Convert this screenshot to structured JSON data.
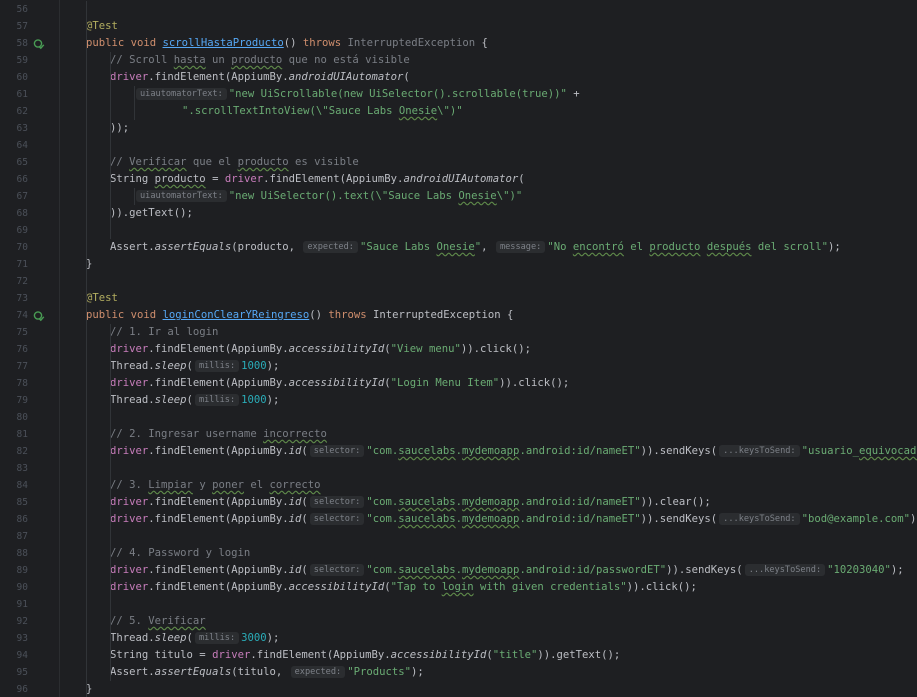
{
  "editor": {
    "language": "java",
    "colors": {
      "background": "#1e1f22",
      "keyword": "#cf8e6d",
      "annotation": "#b3ae60",
      "method": "#56a8f5",
      "field": "#c77dbb",
      "string": "#6aab73",
      "number": "#2aacb8",
      "comment": "#7a7e85",
      "run_icon": "#499c54"
    },
    "run_icons": [
      "run-test-icon",
      "run-test-icon"
    ],
    "lines": [
      {
        "n": "56",
        "indent": 0,
        "parts": []
      },
      {
        "n": "57",
        "indent": 0,
        "parts": [
          {
            "t": "@Test",
            "c": "ann"
          }
        ]
      },
      {
        "n": "58",
        "indent": 0,
        "run": true,
        "parts": [
          {
            "t": "public ",
            "c": "kw"
          },
          {
            "t": "void ",
            "c": "kw"
          },
          {
            "t": "scrollHastaProducto",
            "c": "fn ul"
          },
          {
            "t": "() "
          },
          {
            "t": "throws ",
            "c": "kw"
          },
          {
            "t": "InterruptedException",
            "c": "cmt"
          },
          {
            "t": " {"
          }
        ]
      },
      {
        "n": "59",
        "indent": 1,
        "parts": [
          {
            "t": "// Scroll ",
            "c": "cmt"
          },
          {
            "t": "hasta",
            "c": "cmt typo"
          },
          {
            "t": " un ",
            "c": "cmt"
          },
          {
            "t": "producto",
            "c": "cmt typo"
          },
          {
            "t": " que no está visible",
            "c": "cmt"
          }
        ]
      },
      {
        "n": "60",
        "indent": 1,
        "parts": [
          {
            "t": "driver",
            "c": "fld"
          },
          {
            "t": ".findElement(AppiumBy."
          },
          {
            "t": "androidUIAutomator",
            "c": "ital"
          },
          {
            "t": "("
          }
        ]
      },
      {
        "n": "61",
        "indent": 2,
        "parts": [
          {
            "t": "uiautomatorText:",
            "c": "hint"
          },
          {
            "t": "\"new UiScrollable(new UiSelector().scrollable(true))\"",
            "c": "str"
          },
          {
            "t": " +"
          }
        ]
      },
      {
        "n": "62",
        "indent": 4,
        "parts": [
          {
            "t": "\".scrollTextIntoView(\\\"Sauce Labs ",
            "c": "str"
          },
          {
            "t": "Onesie",
            "c": "str typo"
          },
          {
            "t": "\\\")\"",
            "c": "str"
          }
        ]
      },
      {
        "n": "63",
        "indent": 1,
        "parts": [
          {
            "t": "));"
          }
        ]
      },
      {
        "n": "64",
        "indent": 0,
        "parts": []
      },
      {
        "n": "65",
        "indent": 1,
        "parts": [
          {
            "t": "// ",
            "c": "cmt"
          },
          {
            "t": "Verificar",
            "c": "cmt typo"
          },
          {
            "t": " que el ",
            "c": "cmt"
          },
          {
            "t": "producto",
            "c": "cmt typo"
          },
          {
            "t": " es visible",
            "c": "cmt"
          }
        ]
      },
      {
        "n": "66",
        "indent": 1,
        "parts": [
          {
            "t": "String "
          },
          {
            "t": "producto",
            "c": "typo"
          },
          {
            "t": " = "
          },
          {
            "t": "driver",
            "c": "fld"
          },
          {
            "t": ".findElement(AppiumBy."
          },
          {
            "t": "androidUIAutomator",
            "c": "ital"
          },
          {
            "t": "("
          }
        ]
      },
      {
        "n": "67",
        "indent": 2,
        "parts": [
          {
            "t": "uiautomatorText:",
            "c": "hint"
          },
          {
            "t": "\"new UiSelector().text(\\\"Sauce Labs ",
            "c": "str"
          },
          {
            "t": "Onesie",
            "c": "str typo"
          },
          {
            "t": "\\\")\"",
            "c": "str"
          }
        ]
      },
      {
        "n": "68",
        "indent": 1,
        "parts": [
          {
            "t": ")).getText();"
          }
        ]
      },
      {
        "n": "69",
        "indent": 0,
        "parts": []
      },
      {
        "n": "70",
        "indent": 1,
        "parts": [
          {
            "t": "Assert."
          },
          {
            "t": "assertEquals",
            "c": "ital"
          },
          {
            "t": "(producto, "
          },
          {
            "t": "expected:",
            "c": "hint"
          },
          {
            "t": "\"Sauce Labs ",
            "c": "str"
          },
          {
            "t": "Onesie",
            "c": "str typo"
          },
          {
            "t": "\"",
            "c": "str"
          },
          {
            "t": ", "
          },
          {
            "t": "message:",
            "c": "hint"
          },
          {
            "t": "\"No ",
            "c": "str"
          },
          {
            "t": "encontró",
            "c": "str typo"
          },
          {
            "t": " el ",
            "c": "str"
          },
          {
            "t": "producto",
            "c": "str typo"
          },
          {
            "t": " ",
            "c": "str"
          },
          {
            "t": "después",
            "c": "str typo"
          },
          {
            "t": " del scroll\"",
            "c": "str"
          },
          {
            "t": ");"
          }
        ]
      },
      {
        "n": "71",
        "indent": 0,
        "parts": [
          {
            "t": "}"
          }
        ]
      },
      {
        "n": "72",
        "indent": 0,
        "parts": []
      },
      {
        "n": "73",
        "indent": 0,
        "parts": [
          {
            "t": "@Test",
            "c": "ann"
          }
        ]
      },
      {
        "n": "74",
        "indent": 0,
        "run": true,
        "parts": [
          {
            "t": "public ",
            "c": "kw"
          },
          {
            "t": "void ",
            "c": "kw"
          },
          {
            "t": "loginConClearYReingreso",
            "c": "fn ul"
          },
          {
            "t": "() "
          },
          {
            "t": "throws ",
            "c": "kw"
          },
          {
            "t": "InterruptedException {"
          }
        ]
      },
      {
        "n": "75",
        "indent": 1,
        "parts": [
          {
            "t": "// 1. Ir al login",
            "c": "cmt"
          }
        ]
      },
      {
        "n": "76",
        "indent": 1,
        "parts": [
          {
            "t": "driver",
            "c": "fld"
          },
          {
            "t": ".findElement(AppiumBy."
          },
          {
            "t": "accessibilityId",
            "c": "ital"
          },
          {
            "t": "("
          },
          {
            "t": "\"View menu\"",
            "c": "str"
          },
          {
            "t": ")).click();"
          }
        ]
      },
      {
        "n": "77",
        "indent": 1,
        "parts": [
          {
            "t": "Thread."
          },
          {
            "t": "sleep",
            "c": "ital"
          },
          {
            "t": "("
          },
          {
            "t": "millis:",
            "c": "hint"
          },
          {
            "t": "1000",
            "c": "num-lit"
          },
          {
            "t": ");"
          }
        ]
      },
      {
        "n": "78",
        "indent": 1,
        "parts": [
          {
            "t": "driver",
            "c": "fld"
          },
          {
            "t": ".findElement(AppiumBy."
          },
          {
            "t": "accessibilityId",
            "c": "ital"
          },
          {
            "t": "("
          },
          {
            "t": "\"Login Menu Item\"",
            "c": "str"
          },
          {
            "t": ")).click();"
          }
        ]
      },
      {
        "n": "79",
        "indent": 1,
        "parts": [
          {
            "t": "Thread."
          },
          {
            "t": "sleep",
            "c": "ital"
          },
          {
            "t": "("
          },
          {
            "t": "millis:",
            "c": "hint"
          },
          {
            "t": "1000",
            "c": "num-lit"
          },
          {
            "t": ");"
          }
        ]
      },
      {
        "n": "80",
        "indent": 0,
        "parts": []
      },
      {
        "n": "81",
        "indent": 1,
        "parts": [
          {
            "t": "// 2. Ingresar username ",
            "c": "cmt"
          },
          {
            "t": "incorrecto",
            "c": "cmt typo"
          }
        ]
      },
      {
        "n": "82",
        "indent": 1,
        "parts": [
          {
            "t": "driver",
            "c": "fld"
          },
          {
            "t": ".findElement(AppiumBy."
          },
          {
            "t": "id",
            "c": "ital"
          },
          {
            "t": "("
          },
          {
            "t": "selector:",
            "c": "hint"
          },
          {
            "t": "\"com.",
            "c": "str"
          },
          {
            "t": "saucelabs",
            "c": "str typo"
          },
          {
            "t": ".",
            "c": "str"
          },
          {
            "t": "mydemoapp",
            "c": "str typo"
          },
          {
            "t": ".android:id/nameET\"",
            "c": "str"
          },
          {
            "t": ")).sendKeys("
          },
          {
            "t": "...keysToSend:",
            "c": "hint"
          },
          {
            "t": "\"usuario_",
            "c": "str"
          },
          {
            "t": "equivocado",
            "c": "str typo"
          },
          {
            "t": "\"",
            "c": "str"
          },
          {
            "t": ");"
          }
        ]
      },
      {
        "n": "83",
        "indent": 0,
        "parts": []
      },
      {
        "n": "84",
        "indent": 1,
        "parts": [
          {
            "t": "// 3. ",
            "c": "cmt"
          },
          {
            "t": "Limpiar",
            "c": "cmt typo"
          },
          {
            "t": " y ",
            "c": "cmt"
          },
          {
            "t": "poner",
            "c": "cmt typo"
          },
          {
            "t": " el ",
            "c": "cmt"
          },
          {
            "t": "correcto",
            "c": "cmt typo"
          }
        ]
      },
      {
        "n": "85",
        "indent": 1,
        "parts": [
          {
            "t": "driver",
            "c": "fld"
          },
          {
            "t": ".findElement(AppiumBy."
          },
          {
            "t": "id",
            "c": "ital"
          },
          {
            "t": "("
          },
          {
            "t": "selector:",
            "c": "hint"
          },
          {
            "t": "\"com.",
            "c": "str"
          },
          {
            "t": "saucelabs",
            "c": "str typo"
          },
          {
            "t": ".",
            "c": "str"
          },
          {
            "t": "mydemoapp",
            "c": "str typo"
          },
          {
            "t": ".android:id/nameET\"",
            "c": "str"
          },
          {
            "t": ")).clear();"
          }
        ]
      },
      {
        "n": "86",
        "indent": 1,
        "parts": [
          {
            "t": "driver",
            "c": "fld"
          },
          {
            "t": ".findElement(AppiumBy."
          },
          {
            "t": "id",
            "c": "ital"
          },
          {
            "t": "("
          },
          {
            "t": "selector:",
            "c": "hint"
          },
          {
            "t": "\"com.",
            "c": "str"
          },
          {
            "t": "saucelabs",
            "c": "str typo"
          },
          {
            "t": ".",
            "c": "str"
          },
          {
            "t": "mydemoapp",
            "c": "str typo"
          },
          {
            "t": ".android:id/nameET\"",
            "c": "str"
          },
          {
            "t": ")).sendKeys("
          },
          {
            "t": "...keysToSend:",
            "c": "hint"
          },
          {
            "t": "\"bod@example.com\"",
            "c": "str"
          },
          {
            "t": ");"
          }
        ]
      },
      {
        "n": "87",
        "indent": 0,
        "parts": []
      },
      {
        "n": "88",
        "indent": 1,
        "parts": [
          {
            "t": "// 4. Password y login",
            "c": "cmt"
          }
        ]
      },
      {
        "n": "89",
        "indent": 1,
        "parts": [
          {
            "t": "driver",
            "c": "fld"
          },
          {
            "t": ".findElement(AppiumBy."
          },
          {
            "t": "id",
            "c": "ital"
          },
          {
            "t": "("
          },
          {
            "t": "selector:",
            "c": "hint"
          },
          {
            "t": "\"com.",
            "c": "str"
          },
          {
            "t": "saucelabs",
            "c": "str typo"
          },
          {
            "t": ".",
            "c": "str"
          },
          {
            "t": "mydemoapp",
            "c": "str typo"
          },
          {
            "t": ".android:id/passwordET\"",
            "c": "str"
          },
          {
            "t": ")).sendKeys("
          },
          {
            "t": "...keysToSend:",
            "c": "hint"
          },
          {
            "t": "\"10203040\"",
            "c": "str"
          },
          {
            "t": ");"
          }
        ]
      },
      {
        "n": "90",
        "indent": 1,
        "parts": [
          {
            "t": "driver",
            "c": "fld"
          },
          {
            "t": ".findElement(AppiumBy."
          },
          {
            "t": "accessibilityId",
            "c": "ital"
          },
          {
            "t": "("
          },
          {
            "t": "\"Tap to ",
            "c": "str"
          },
          {
            "t": "login",
            "c": "str typo"
          },
          {
            "t": " with given credentials\"",
            "c": "str"
          },
          {
            "t": ")).click();"
          }
        ]
      },
      {
        "n": "91",
        "indent": 0,
        "parts": []
      },
      {
        "n": "92",
        "indent": 1,
        "parts": [
          {
            "t": "// 5. ",
            "c": "cmt"
          },
          {
            "t": "Verificar",
            "c": "cmt typo"
          }
        ]
      },
      {
        "n": "93",
        "indent": 1,
        "parts": [
          {
            "t": "Thread."
          },
          {
            "t": "sleep",
            "c": "ital"
          },
          {
            "t": "("
          },
          {
            "t": "millis:",
            "c": "hint"
          },
          {
            "t": "3000",
            "c": "num-lit"
          },
          {
            "t": ");"
          }
        ]
      },
      {
        "n": "94",
        "indent": 1,
        "parts": [
          {
            "t": "String titulo = "
          },
          {
            "t": "driver",
            "c": "fld"
          },
          {
            "t": ".findElement(AppiumBy."
          },
          {
            "t": "accessibilityId",
            "c": "ital"
          },
          {
            "t": "("
          },
          {
            "t": "\"title\"",
            "c": "str"
          },
          {
            "t": ")).getText();"
          }
        ]
      },
      {
        "n": "95",
        "indent": 1,
        "parts": [
          {
            "t": "Assert."
          },
          {
            "t": "assertEquals",
            "c": "ital"
          },
          {
            "t": "(titulo, "
          },
          {
            "t": "expected:",
            "c": "hint"
          },
          {
            "t": "\"Products\"",
            "c": "str"
          },
          {
            "t": ");"
          }
        ]
      },
      {
        "n": "96",
        "indent": 0,
        "parts": [
          {
            "t": "}"
          }
        ]
      }
    ]
  }
}
